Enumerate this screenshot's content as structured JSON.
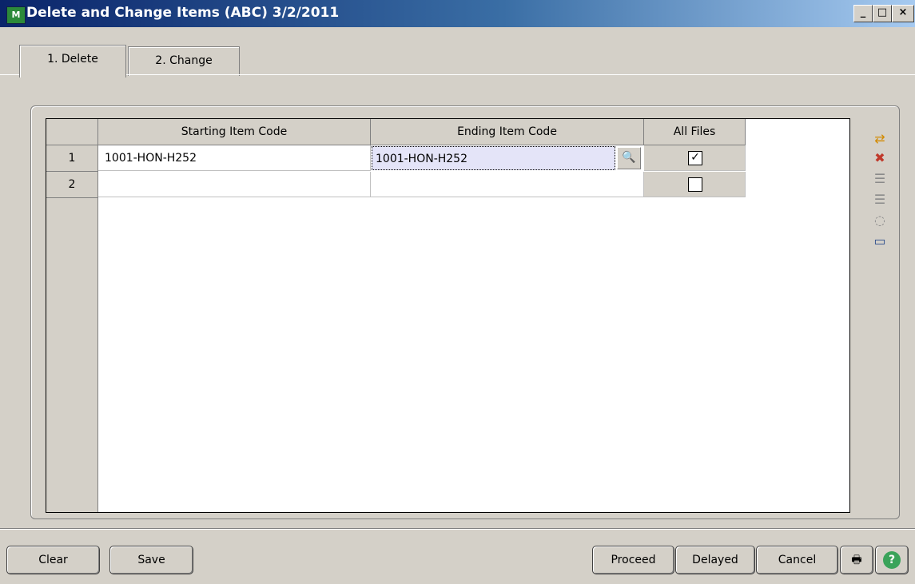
{
  "window": {
    "title": "Delete and Change Items (ABC) 3/2/2011",
    "controls": {
      "minimize": "_",
      "maximize": "□",
      "close": "×"
    }
  },
  "tabs": [
    {
      "label": "1. Delete",
      "active": true
    },
    {
      "label": "2. Change",
      "active": false
    }
  ],
  "grid": {
    "columns": [
      "Starting Item Code",
      "Ending Item Code",
      "All Files"
    ],
    "rows": [
      {
        "num": "1",
        "starting": "1001-HON-H252",
        "ending": "1001-HON-H252",
        "all_files": true
      },
      {
        "num": "2",
        "starting": "",
        "ending": "",
        "all_files": false
      }
    ]
  },
  "toolbar_icons": [
    "insert-row-icon",
    "delete-row-icon",
    "indent-icon",
    "outdent-icon",
    "select-icon",
    "grid-settings-icon"
  ],
  "buttons": {
    "clear": "Clear",
    "save": "Save",
    "proceed": "Proceed",
    "delayed": "Delayed",
    "cancel": "Cancel"
  }
}
